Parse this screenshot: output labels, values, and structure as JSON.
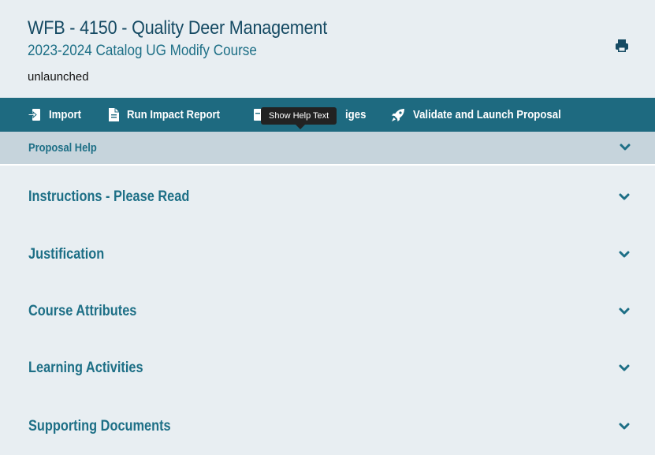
{
  "header": {
    "title": "WFB - 4150 - Quality Deer Management",
    "subtitle": "2023-2024 Catalog UG Modify Course",
    "status": "unlaunched",
    "print_icon": "printer-icon"
  },
  "toolbar": {
    "import_label": "Import",
    "run_impact_label": "Run Impact Report",
    "changes_label": "iges",
    "validate_label": "Validate and Launch Proposal"
  },
  "tooltip": {
    "text": "Show Help Text"
  },
  "help_bar": {
    "label": "Proposal Help"
  },
  "sections": [
    {
      "label": "Instructions - Please Read"
    },
    {
      "label": "Justification"
    },
    {
      "label": "Course Attributes"
    },
    {
      "label": "Learning Activities"
    },
    {
      "label": "Supporting Documents"
    }
  ],
  "colors": {
    "background": "#e8eef2",
    "toolbar": "#1e6a80",
    "help_bar": "#c6d4dc",
    "title": "#154a63",
    "accent": "#1d6f86"
  }
}
